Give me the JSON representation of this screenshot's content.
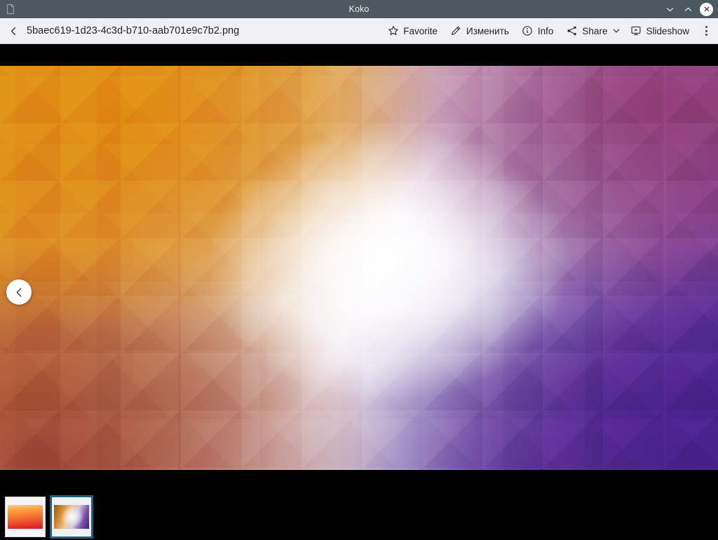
{
  "window": {
    "title": "Koko",
    "app_icon": "image-file-icon",
    "controls": [
      {
        "name": "minimize",
        "glyph": "minimize-icon"
      },
      {
        "name": "maximize",
        "glyph": "maximize-icon"
      },
      {
        "name": "close",
        "glyph": "close-icon"
      }
    ]
  },
  "toolbar": {
    "back_icon": "chevron-left-icon",
    "filename": "5baec619-1d23-4c3d-b710-aab701e9c7b2.png",
    "actions": [
      {
        "id": "favorite",
        "label": "Favorite",
        "icon": "star-outline-icon"
      },
      {
        "id": "edit",
        "label": "Изменить",
        "icon": "pencil-icon"
      },
      {
        "id": "info",
        "label": "Info",
        "icon": "info-circle-icon"
      },
      {
        "id": "share",
        "label": "Share",
        "icon": "share-nodes-icon",
        "has_dropdown": true
      },
      {
        "id": "slideshow",
        "label": "Slideshow",
        "icon": "slideshow-screen-icon"
      }
    ],
    "overflow_icon": "more-vertical-icon"
  },
  "viewer": {
    "prev_button_icon": "chevron-left-icon",
    "background_color": "#000000",
    "image_description": "low-poly gradient wallpaper",
    "image_colors": {
      "top_left": "#d9861a",
      "top_right": "#8e3a74",
      "bottom_left": "#9c4636",
      "bottom_right": "#4d2494",
      "center": "#f7f4f8"
    }
  },
  "thumbnails": {
    "selected_index": 1,
    "selection_color": "#1f5f7d",
    "items": [
      {
        "id": "thumb-1",
        "variant": "t1",
        "selected": false
      },
      {
        "id": "thumb-2",
        "variant": "t2",
        "selected": true
      }
    ]
  }
}
